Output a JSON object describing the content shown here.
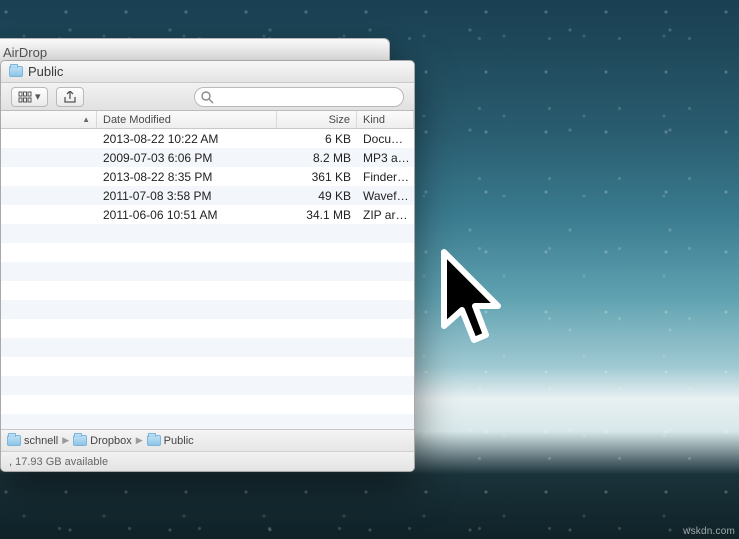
{
  "back_window": {
    "title": "AirDrop"
  },
  "finder": {
    "title": "Public",
    "toolbar": {
      "view_button": "icon-grid",
      "share_button": "share"
    },
    "search": {
      "placeholder": ""
    },
    "columns": {
      "name": "",
      "date": "Date Modified",
      "size": "Size",
      "kind": "Kind"
    },
    "rows": [
      {
        "date": "2013-08-22 10:22 AM",
        "size": "6 KB",
        "kind": "Docu…"
      },
      {
        "date": "2009-07-03 6:06 PM",
        "size": "8.2 MB",
        "kind": "MP3 a…"
      },
      {
        "date": "2013-08-22 8:35 PM",
        "size": "361 KB",
        "kind": "Finder…"
      },
      {
        "date": "2011-07-08 3:58 PM",
        "size": "49 KB",
        "kind": "Wavef…"
      },
      {
        "date": "2011-06-06 10:51 AM",
        "size": "34.1 MB",
        "kind": "ZIP ar…"
      }
    ],
    "path": [
      {
        "label": "schnell"
      },
      {
        "label": "Dropbox"
      },
      {
        "label": "Public"
      }
    ],
    "status": ", 17.93 GB available"
  },
  "watermark": "wskdn.com"
}
